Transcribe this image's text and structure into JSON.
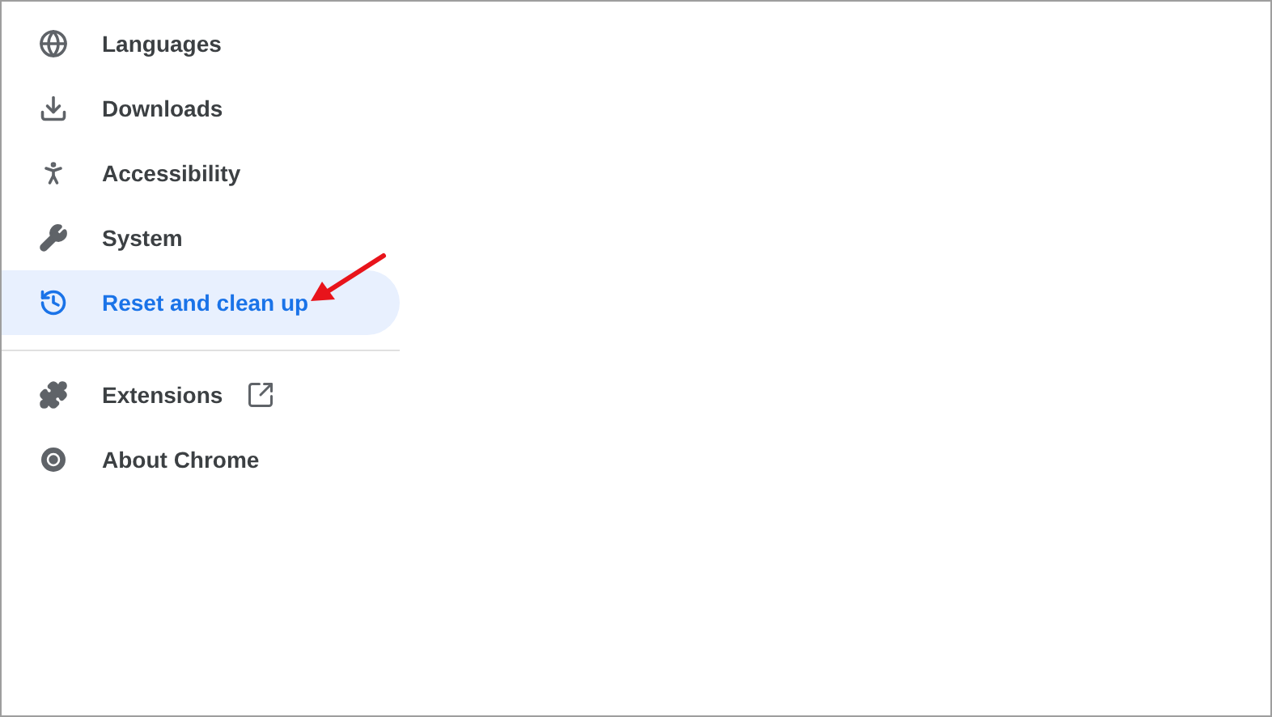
{
  "sidebar": {
    "sections": [
      {
        "items": [
          {
            "kind": "globe",
            "label": "Languages",
            "selected": false,
            "external": false
          },
          {
            "kind": "download",
            "label": "Downloads",
            "selected": false,
            "external": false
          },
          {
            "kind": "accessibility",
            "label": "Accessibility",
            "selected": false,
            "external": false
          },
          {
            "kind": "wrench",
            "label": "System",
            "selected": false,
            "external": false
          },
          {
            "kind": "history",
            "label": "Reset and clean up",
            "selected": true,
            "external": false
          }
        ]
      },
      {
        "items": [
          {
            "kind": "puzzle",
            "label": "Extensions",
            "selected": false,
            "external": true
          },
          {
            "kind": "chrome",
            "label": "About Chrome",
            "selected": false,
            "external": false
          }
        ]
      }
    ]
  }
}
